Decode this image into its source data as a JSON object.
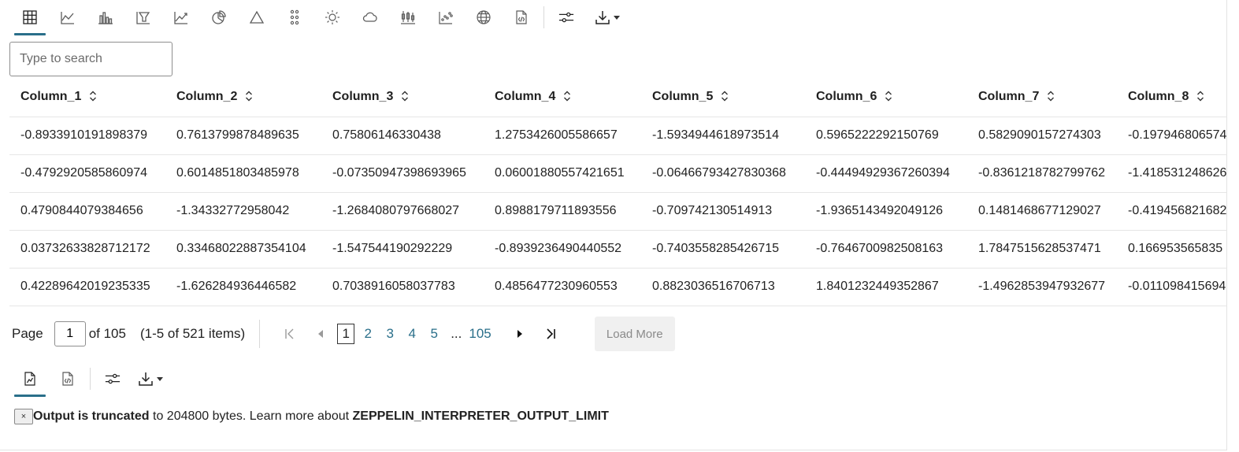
{
  "toolbar": {
    "icons": [
      "table-icon",
      "line-chart-icon",
      "bar-chart-icon",
      "funnel-chart-icon",
      "area-chart-icon",
      "pie-chart-icon",
      "pyramid-icon",
      "scatter-dots-icon",
      "sun-icon",
      "cloud-icon",
      "boxplot-icon",
      "scatter-plot-icon",
      "globe-icon",
      "code-file-icon",
      "settings-sliders-icon",
      "download-icon"
    ],
    "active": "table-icon"
  },
  "search": {
    "placeholder": "Type to search"
  },
  "table": {
    "columns": [
      "Column_1",
      "Column_2",
      "Column_3",
      "Column_4",
      "Column_5",
      "Column_6",
      "Column_7",
      "Column_8"
    ],
    "rows": [
      [
        "-0.8933910191898379",
        "0.7613799878489635",
        "0.75806146330438",
        "1.2753426005586657",
        "-1.5934944618973514",
        "0.5965222292150769",
        "0.5829090157274303",
        "-0.197946806574"
      ],
      [
        "-0.4792920585860974",
        "0.6014851803485978",
        "-0.07350947398693965",
        "0.06001880557421651",
        "-0.06466793427830368",
        "-0.44494929367260394",
        "-0.8361218782799762",
        "-1.418531248626"
      ],
      [
        "0.4790844079384656",
        "-1.34332772958042",
        "-1.2684080797668027",
        "0.8988179711893556",
        "-0.709742130514913",
        "-1.9365143492049126",
        "0.1481468677129027",
        "-0.419456821682"
      ],
      [
        "0.03732633828712172",
        "0.33468022887354104",
        "-1.547544190292229",
        "-0.8939236490440552",
        "-0.7403558285426715",
        "-0.7646700982508163",
        "1.7847515628537471",
        "0.166953565835"
      ],
      [
        "0.42289642019235335",
        "-1.626284936446582",
        "0.7038916058037783",
        "0.4856477230960553",
        "0.8823036516706713",
        "1.8401232449352867",
        "-1.4962853947932677",
        "-0.011098415694"
      ]
    ]
  },
  "pagination": {
    "page_label": "Page",
    "page_value": "1",
    "of_label": "of 105",
    "range_label": "(1-5 of 521 items)",
    "pages": [
      "1",
      "2",
      "3",
      "4",
      "5"
    ],
    "ellipsis": "...",
    "last_page": "105",
    "load_more": "Load More"
  },
  "toolbar2": {
    "icons": [
      "chart-file-icon",
      "code-file-icon",
      "settings-sliders-icon",
      "download-icon"
    ],
    "active": "chart-file-icon"
  },
  "notice": {
    "close": "×",
    "bold_text": "Output is truncated",
    "text": " to 204800 bytes. Learn more about ",
    "link_text": "ZEPPELIN_INTERPRETER_OUTPUT_LIMIT"
  }
}
